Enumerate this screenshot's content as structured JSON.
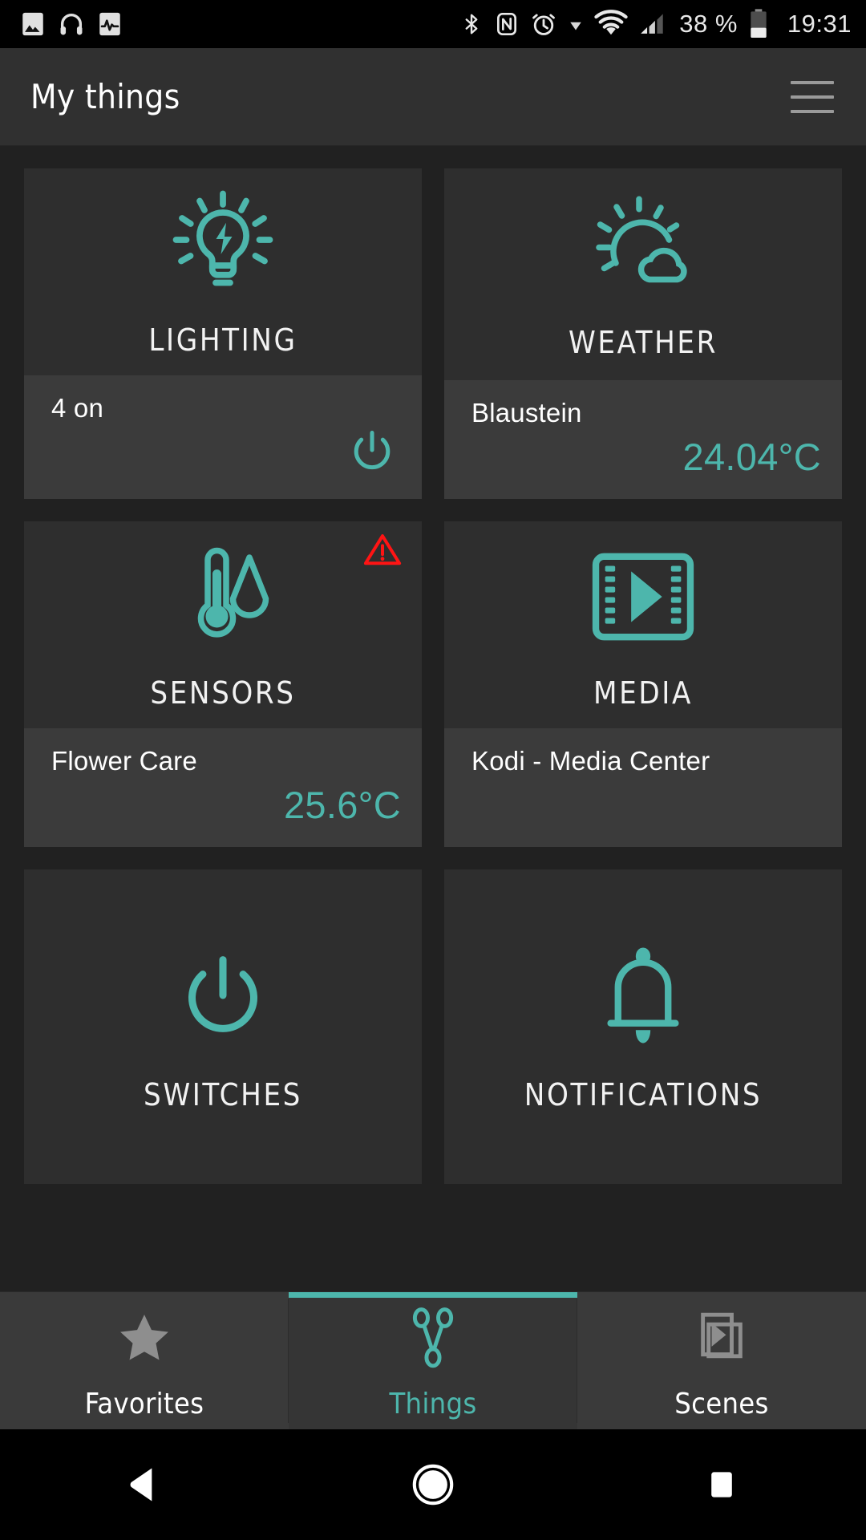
{
  "status_bar": {
    "left_icons": [
      "image-icon",
      "headphones-icon",
      "activity-icon"
    ],
    "right_icons": [
      "bluetooth-icon",
      "nfc-icon",
      "alarm-icon",
      "dropdown-icon",
      "wifi-icon",
      "signal-icon"
    ],
    "battery_percent": "38 %",
    "battery_icon": "battery-icon",
    "time": "19:31"
  },
  "app_bar": {
    "title": "My things",
    "menu_icon": "hamburger-menu-icon"
  },
  "theme": {
    "accent": "#4DB6AC",
    "warning": "#FF0000",
    "card_bg": "#2E2E2E",
    "footer_bg": "#3B3B3B",
    "page_bg": "#212121"
  },
  "cards": [
    {
      "id": "lighting",
      "title": "LIGHTING",
      "icon": "lightbulb-icon",
      "warning": false,
      "footer": {
        "name": "4 on",
        "value": "",
        "control_icon": "power-icon"
      }
    },
    {
      "id": "weather",
      "title": "WEATHER",
      "icon": "sun-cloud-icon",
      "warning": false,
      "footer": {
        "name": "Blaustein",
        "value": "24.04°C",
        "control_icon": ""
      }
    },
    {
      "id": "sensors",
      "title": "SENSORS",
      "icon": "thermometer-droplet-icon",
      "warning": true,
      "warning_icon": "warning-triangle-icon",
      "footer": {
        "name": "Flower Care",
        "value": "25.6°C",
        "control_icon": ""
      }
    },
    {
      "id": "media",
      "title": "MEDIA",
      "icon": "film-play-icon",
      "warning": false,
      "footer": {
        "name": "Kodi - Media Center",
        "value": "",
        "control_icon": ""
      }
    },
    {
      "id": "switches",
      "title": "SWITCHES",
      "icon": "power-icon",
      "warning": false,
      "footer": null
    },
    {
      "id": "notifications",
      "title": "NOTIFICATIONS",
      "icon": "bell-icon",
      "warning": false,
      "footer": null
    }
  ],
  "tabs": [
    {
      "id": "favorites",
      "label": "Favorites",
      "icon": "star-icon",
      "active": false
    },
    {
      "id": "things",
      "label": "Things",
      "icon": "things-node-icon",
      "active": true
    },
    {
      "id": "scenes",
      "label": "Scenes",
      "icon": "scenes-stack-icon",
      "active": false
    }
  ],
  "nav_bar": {
    "back_icon": "back-triangle-icon",
    "home_icon": "home-circle-icon",
    "recents_icon": "recents-square-icon"
  }
}
